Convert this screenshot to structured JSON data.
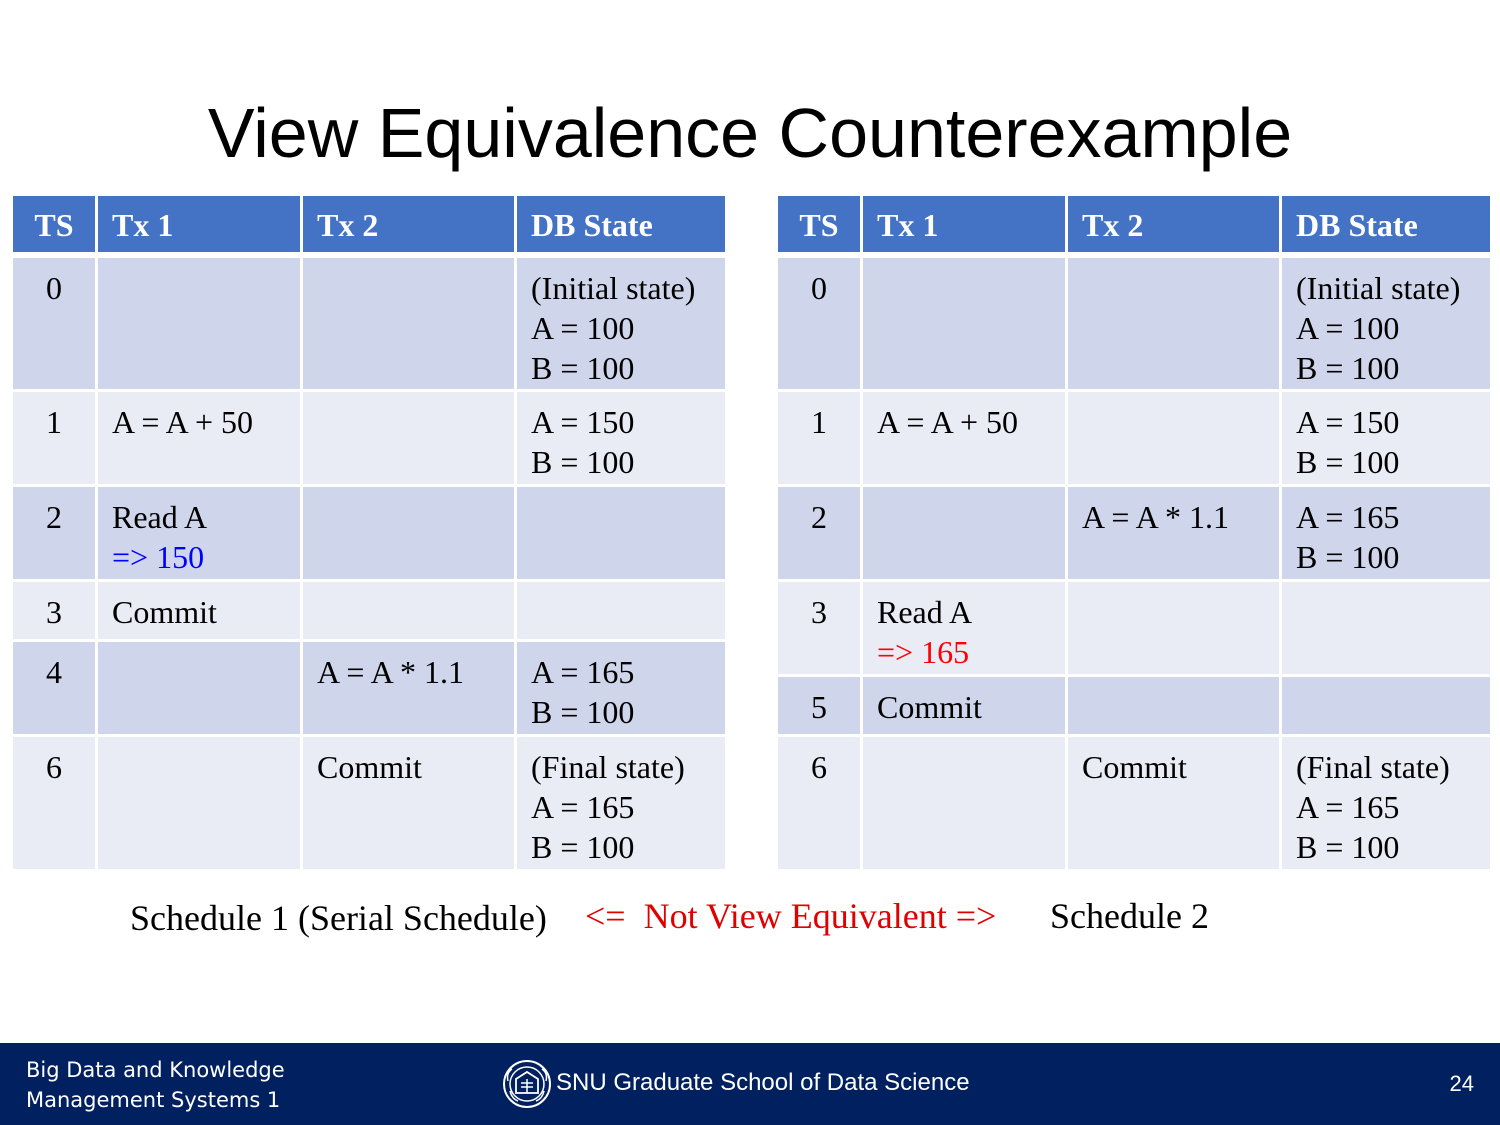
{
  "title": "View Equivalence Counterexample",
  "headers": [
    "TS",
    "Tx 1",
    "Tx 2",
    "DB State"
  ],
  "schedule1": {
    "rows": [
      {
        "ts": "0",
        "tx1": [],
        "tx2": [],
        "db": [
          "(Initial state)",
          "A = 100",
          "B = 100"
        ]
      },
      {
        "ts": "1",
        "tx1": [
          "A = A + 50"
        ],
        "tx2": [],
        "db": [
          "A = 150",
          "B = 100"
        ]
      },
      {
        "ts": "2",
        "tx1": [
          "Read A",
          "=> 150"
        ],
        "tx2": [],
        "db": []
      },
      {
        "ts": "3",
        "tx1": [
          "Commit"
        ],
        "tx2": [],
        "db": []
      },
      {
        "ts": "4",
        "tx1": [],
        "tx2": [
          "A = A * 1.1"
        ],
        "db": [
          "A = 165",
          "B = 100"
        ]
      },
      {
        "ts": "6",
        "tx1": [],
        "tx2": [
          "Commit"
        ],
        "db": [
          "(Final state)",
          "A = 165",
          "B = 100"
        ]
      }
    ],
    "caption": "Schedule 1 (Serial Schedule)"
  },
  "schedule2": {
    "rows": [
      {
        "ts": "0",
        "tx1": [],
        "tx2": [],
        "db": [
          "(Initial state)",
          "A = 100",
          "B = 100"
        ]
      },
      {
        "ts": "1",
        "tx1": [
          "A = A + 50"
        ],
        "tx2": [],
        "db": [
          "A = 150",
          "B = 100"
        ]
      },
      {
        "ts": "2",
        "tx1": [],
        "tx2": [
          "A = A * 1.1"
        ],
        "db": [
          "A = 165",
          "B = 100"
        ]
      },
      {
        "ts": "3",
        "tx1": [
          "Read A",
          "=> 165"
        ],
        "tx2": [],
        "db": []
      },
      {
        "ts": "5",
        "tx1": [
          "Commit"
        ],
        "tx2": [],
        "db": []
      },
      {
        "ts": "6",
        "tx1": [],
        "tx2": [
          "Commit"
        ],
        "db": [
          "(Final state)",
          "A = 165",
          "B = 100"
        ]
      }
    ],
    "caption": "Schedule 2"
  },
  "middle_caption": "<=  Not View Equivalent =>",
  "colors": {
    "header_bg": "#4472c4",
    "row_dark": "#cfd5ea",
    "row_light": "#e9ebf5",
    "read_result_1": "#0000ff",
    "read_result_2": "#ff0000",
    "not_equivalent": "#e00000",
    "footer_bg": "#002060"
  },
  "footer": {
    "course_line1": "Big Data and Knowledge",
    "course_line2": "Management Systems 1",
    "school": "SNU Graduate School of Data Science",
    "page": "24",
    "logo_icon": "snu-emblem-icon"
  }
}
